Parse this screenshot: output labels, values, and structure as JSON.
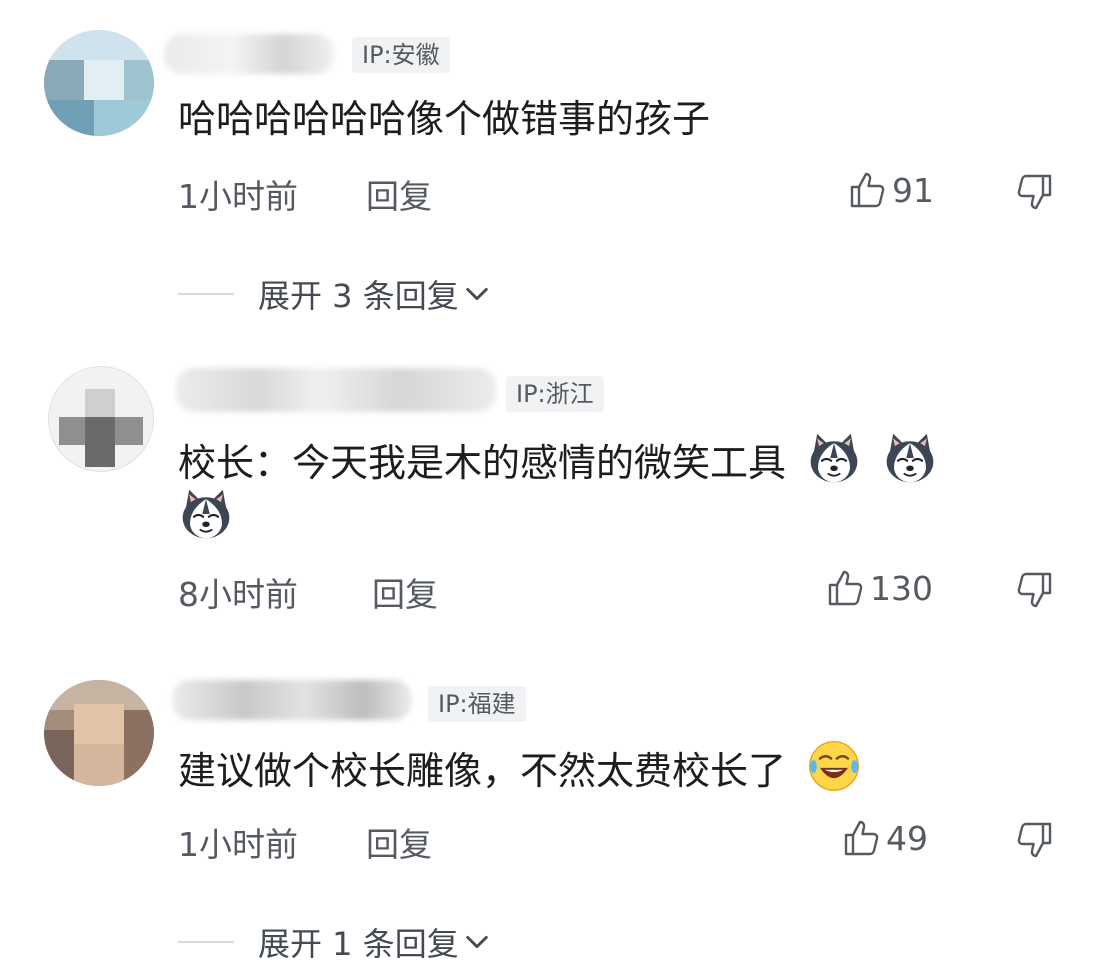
{
  "comments": [
    {
      "ip": "IP:安徽",
      "text": "哈哈哈哈哈哈像个做错事的孩子",
      "time": "1小时前",
      "reply": "回复",
      "likes": "91",
      "expand": "展开 3 条回复"
    },
    {
      "ip": "IP:浙江",
      "text": "校长：今天我是木的感情的微笑工具",
      "time": "8小时前",
      "reply": "回复",
      "likes": "130"
    },
    {
      "ip": "IP:福建",
      "text": "建议做个校长雕像，不然太费校长了",
      "time": "1小时前",
      "reply": "回复",
      "likes": "49",
      "expand": "展开 1 条回复"
    }
  ],
  "icons": {
    "like": "thumbs-up-icon",
    "dislike": "thumbs-down-icon",
    "expand": "chevron-down-icon",
    "husky_emoji": "husky-dog-emoji",
    "laugh_cry_emoji": "laugh-cry-emoji"
  },
  "colors": {
    "text": "#1d1d1f",
    "meta": "#555a61",
    "tag_bg": "#f1f2f4"
  }
}
